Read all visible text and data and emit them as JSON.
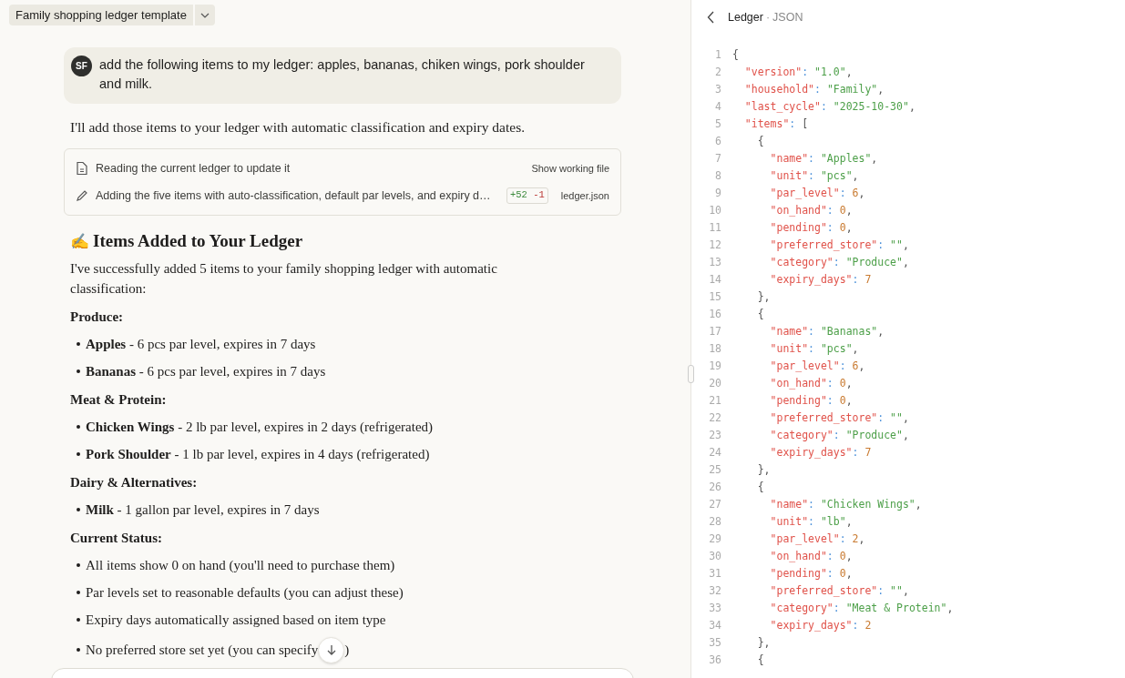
{
  "chat_title": {
    "label": "Family shopping ledger template"
  },
  "user_message": {
    "avatar": "SF",
    "text": "add the following items to my ledger: apples, bananas, chiken wings, pork shoulder and milk."
  },
  "assistant": {
    "intro": "I'll add those items to your ledger with automatic classification and expiry dates.",
    "tool_steps": [
      {
        "kind": "read",
        "text": "Reading the current ledger to update it",
        "action": "Show working file"
      },
      {
        "kind": "edit",
        "text": "Adding the five items with auto-classification, default par levels, and expiry d…",
        "added": "+52",
        "removed": "-1",
        "file": "ledger.json"
      }
    ],
    "heading_emoji": "✍️",
    "heading": "Items Added to Your Ledger",
    "summary": "I've successfully added 5 items to your family shopping ledger with automatic classification:",
    "sections": [
      {
        "heading": "Produce:",
        "bullets": [
          "**Apples** - 6 pcs par level, expires in 7 days",
          "**Bananas** - 6 pcs par level, expires in 7 days"
        ]
      },
      {
        "heading": "Meat & Protein:",
        "bullets": [
          "**Chicken Wings** - 2 lb par level, expires in 2 days (refrigerated)",
          "**Pork Shoulder** - 1 lb par level, expires in 4 days (refrigerated)"
        ]
      },
      {
        "heading": "Dairy & Alternatives:",
        "bullets": [
          "**Milk** - 1 gallon par level, expires in 7 days"
        ]
      },
      {
        "heading": "Current Status:",
        "bullets": [
          "All items show 0 on hand (you'll need to purchase them)",
          "Par levels set to reasonable defaults (you can adjust these)",
          "Expiry days automatically assigned based on item type"
        ]
      }
    ],
    "last_bullet": {
      "text": "No preferred store set yet (you can specify",
      "tail": ")"
    }
  },
  "file_panel": {
    "title": "Ledger",
    "separator": "·",
    "subtitle": "JSON",
    "lines": [
      {
        "number": "1",
        "tokens": [
          {
            "kind": "punct",
            "text": "{"
          }
        ]
      },
      {
        "number": "2",
        "tokens": [
          {
            "kind": "key",
            "text": "\"version\""
          },
          {
            "kind": "colon",
            "text": ": "
          },
          {
            "kind": "string",
            "text": "\"1.0\""
          },
          {
            "kind": "punct",
            "text": ","
          }
        ]
      },
      {
        "number": "3",
        "tokens": [
          {
            "kind": "key",
            "text": "\"household\""
          },
          {
            "kind": "colon",
            "text": ": "
          },
          {
            "kind": "string",
            "text": "\"Family\""
          },
          {
            "kind": "punct",
            "text": ","
          }
        ]
      },
      {
        "number": "4",
        "tokens": [
          {
            "kind": "key",
            "text": "\"last_cycle\""
          },
          {
            "kind": "colon",
            "text": ": "
          },
          {
            "kind": "string",
            "text": "\"2025-10-30\""
          },
          {
            "kind": "punct",
            "text": ","
          }
        ]
      },
      {
        "number": "5",
        "tokens": [
          {
            "kind": "key",
            "text": "\"items\""
          },
          {
            "kind": "colon",
            "text": ": "
          },
          {
            "kind": "punct",
            "text": "["
          }
        ]
      },
      {
        "number": "6",
        "tokens": [
          {
            "kind": "punct",
            "text": "{"
          }
        ]
      },
      {
        "number": "7",
        "tokens": [
          {
            "kind": "key",
            "text": "\"name\""
          },
          {
            "kind": "colon",
            "text": ": "
          },
          {
            "kind": "string",
            "text": "\"Apples\""
          },
          {
            "kind": "punct",
            "text": ","
          }
        ]
      },
      {
        "number": "8",
        "tokens": [
          {
            "kind": "key",
            "text": "\"unit\""
          },
          {
            "kind": "colon",
            "text": ": "
          },
          {
            "kind": "string",
            "text": "\"pcs\""
          },
          {
            "kind": "punct",
            "text": ","
          }
        ]
      },
      {
        "number": "9",
        "tokens": [
          {
            "kind": "key",
            "text": "\"par_level\""
          },
          {
            "kind": "colon",
            "text": ": "
          },
          {
            "kind": "number",
            "text": "6"
          },
          {
            "kind": "punct",
            "text": ","
          }
        ]
      },
      {
        "number": "10",
        "tokens": [
          {
            "kind": "key",
            "text": "\"on_hand\""
          },
          {
            "kind": "colon",
            "text": ": "
          },
          {
            "kind": "number",
            "text": "0"
          },
          {
            "kind": "punct",
            "text": ","
          }
        ]
      },
      {
        "number": "11",
        "tokens": [
          {
            "kind": "key",
            "text": "\"pending\""
          },
          {
            "kind": "colon",
            "text": ": "
          },
          {
            "kind": "number",
            "text": "0"
          },
          {
            "kind": "punct",
            "text": ","
          }
        ]
      },
      {
        "number": "12",
        "tokens": [
          {
            "kind": "key",
            "text": "\"preferred_store\""
          },
          {
            "kind": "colon",
            "text": ": "
          },
          {
            "kind": "string",
            "text": "\"\""
          },
          {
            "kind": "punct",
            "text": ","
          }
        ]
      },
      {
        "number": "13",
        "tokens": [
          {
            "kind": "key",
            "text": "\"category\""
          },
          {
            "kind": "colon",
            "text": ": "
          },
          {
            "kind": "string",
            "text": "\"Produce\""
          },
          {
            "kind": "punct",
            "text": ","
          }
        ]
      },
      {
        "number": "14",
        "tokens": [
          {
            "kind": "key",
            "text": "\"expiry_days\""
          },
          {
            "kind": "colon",
            "text": ": "
          },
          {
            "kind": "number",
            "text": "7"
          }
        ]
      },
      {
        "number": "15",
        "tokens": [
          {
            "kind": "punct",
            "text": "},"
          }
        ]
      },
      {
        "number": "16",
        "tokens": [
          {
            "kind": "punct",
            "text": "{"
          }
        ]
      },
      {
        "number": "17",
        "tokens": [
          {
            "kind": "key",
            "text": "\"name\""
          },
          {
            "kind": "colon",
            "text": ": "
          },
          {
            "kind": "string",
            "text": "\"Bananas\""
          },
          {
            "kind": "punct",
            "text": ","
          }
        ]
      },
      {
        "number": "18",
        "tokens": [
          {
            "kind": "key",
            "text": "\"unit\""
          },
          {
            "kind": "colon",
            "text": ": "
          },
          {
            "kind": "string",
            "text": "\"pcs\""
          },
          {
            "kind": "punct",
            "text": ","
          }
        ]
      },
      {
        "number": "19",
        "tokens": [
          {
            "kind": "key",
            "text": "\"par_level\""
          },
          {
            "kind": "colon",
            "text": ": "
          },
          {
            "kind": "number",
            "text": "6"
          },
          {
            "kind": "punct",
            "text": ","
          }
        ]
      },
      {
        "number": "20",
        "tokens": [
          {
            "kind": "key",
            "text": "\"on_hand\""
          },
          {
            "kind": "colon",
            "text": ": "
          },
          {
            "kind": "number",
            "text": "0"
          },
          {
            "kind": "punct",
            "text": ","
          }
        ]
      },
      {
        "number": "21",
        "tokens": [
          {
            "kind": "key",
            "text": "\"pending\""
          },
          {
            "kind": "colon",
            "text": ": "
          },
          {
            "kind": "number",
            "text": "0"
          },
          {
            "kind": "punct",
            "text": ","
          }
        ]
      },
      {
        "number": "22",
        "tokens": [
          {
            "kind": "key",
            "text": "\"preferred_store\""
          },
          {
            "kind": "colon",
            "text": ": "
          },
          {
            "kind": "string",
            "text": "\"\""
          },
          {
            "kind": "punct",
            "text": ","
          }
        ]
      },
      {
        "number": "23",
        "tokens": [
          {
            "kind": "key",
            "text": "\"category\""
          },
          {
            "kind": "colon",
            "text": ": "
          },
          {
            "kind": "string",
            "text": "\"Produce\""
          },
          {
            "kind": "punct",
            "text": ","
          }
        ]
      },
      {
        "number": "24",
        "tokens": [
          {
            "kind": "key",
            "text": "\"expiry_days\""
          },
          {
            "kind": "colon",
            "text": ": "
          },
          {
            "kind": "number",
            "text": "7"
          }
        ]
      },
      {
        "number": "25",
        "tokens": [
          {
            "kind": "punct",
            "text": "},"
          }
        ]
      },
      {
        "number": "26",
        "tokens": [
          {
            "kind": "punct",
            "text": "{"
          }
        ]
      },
      {
        "number": "27",
        "tokens": [
          {
            "kind": "key",
            "text": "\"name\""
          },
          {
            "kind": "colon",
            "text": ": "
          },
          {
            "kind": "string",
            "text": "\"Chicken Wings\""
          },
          {
            "kind": "punct",
            "text": ","
          }
        ]
      },
      {
        "number": "28",
        "tokens": [
          {
            "kind": "key",
            "text": "\"unit\""
          },
          {
            "kind": "colon",
            "text": ": "
          },
          {
            "kind": "string",
            "text": "\"lb\""
          },
          {
            "kind": "punct",
            "text": ","
          }
        ]
      },
      {
        "number": "29",
        "tokens": [
          {
            "kind": "key",
            "text": "\"par_level\""
          },
          {
            "kind": "colon",
            "text": ": "
          },
          {
            "kind": "number",
            "text": "2"
          },
          {
            "kind": "punct",
            "text": ","
          }
        ]
      },
      {
        "number": "30",
        "tokens": [
          {
            "kind": "key",
            "text": "\"on_hand\""
          },
          {
            "kind": "colon",
            "text": ": "
          },
          {
            "kind": "number",
            "text": "0"
          },
          {
            "kind": "punct",
            "text": ","
          }
        ]
      },
      {
        "number": "31",
        "tokens": [
          {
            "kind": "key",
            "text": "\"pending\""
          },
          {
            "kind": "colon",
            "text": ": "
          },
          {
            "kind": "number",
            "text": "0"
          },
          {
            "kind": "punct",
            "text": ","
          }
        ]
      },
      {
        "number": "32",
        "tokens": [
          {
            "kind": "key",
            "text": "\"preferred_store\""
          },
          {
            "kind": "colon",
            "text": ": "
          },
          {
            "kind": "string",
            "text": "\"\""
          },
          {
            "kind": "punct",
            "text": ","
          }
        ]
      },
      {
        "number": "33",
        "tokens": [
          {
            "kind": "key",
            "text": "\"category\""
          },
          {
            "kind": "colon",
            "text": ": "
          },
          {
            "kind": "string",
            "text": "\"Meat & Protein\""
          },
          {
            "kind": "punct",
            "text": ","
          }
        ]
      },
      {
        "number": "34",
        "tokens": [
          {
            "kind": "key",
            "text": "\"expiry_days\""
          },
          {
            "kind": "colon",
            "text": ": "
          },
          {
            "kind": "number",
            "text": "2"
          }
        ]
      },
      {
        "number": "35",
        "tokens": [
          {
            "kind": "punct",
            "text": "},"
          }
        ]
      },
      {
        "number": "36",
        "tokens": [
          {
            "kind": "punct",
            "text": "{"
          }
        ]
      }
    ]
  }
}
